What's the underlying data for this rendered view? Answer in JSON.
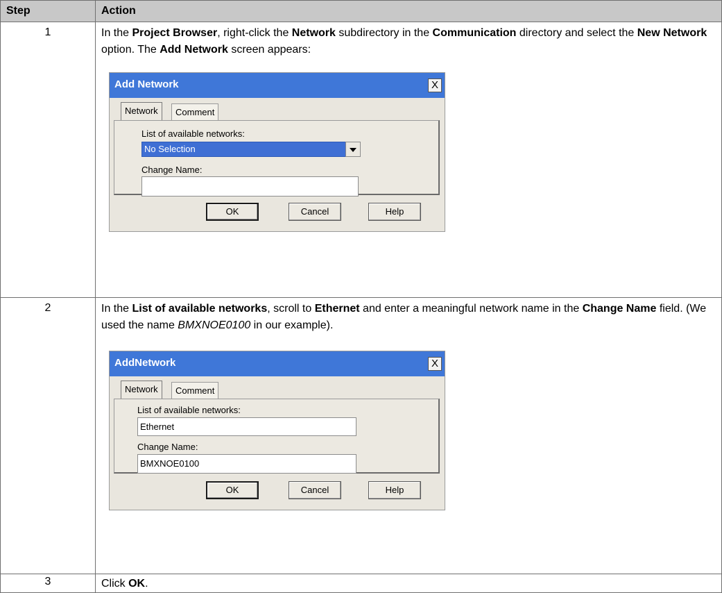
{
  "table": {
    "header_step": "Step",
    "header_action": "Action"
  },
  "rows": [
    {
      "step": "1",
      "text_a": "In the ",
      "bold_a": "Project Browser",
      "text_b": ", right-click the ",
      "bold_b": "Network",
      "text_c": " subdirectory in the ",
      "bold_c": "Communication",
      "text_d": " directory and select the ",
      "bold_d": "New Network",
      "text_e": " option. The ",
      "bold_e": "Add Network",
      "text_f": " screen appears:"
    },
    {
      "step": "2",
      "text_a": "In the ",
      "bold_a": "List of available networks",
      "text_b": ", scroll to ",
      "bold_b": "Ethernet",
      "text_c": " and enter a meaningful network name in the ",
      "bold_c": "Change Name",
      "text_d": " field. (We used the name ",
      "italic_d": "BMXNOE0100",
      "text_e": " in our example)."
    },
    {
      "step": "3",
      "text_a": "Click ",
      "bold_a": "OK",
      "text_b": "."
    }
  ],
  "dialog1": {
    "title": "Add Network",
    "close": "X",
    "tab_network": "Network",
    "tab_comment": "Comment",
    "list_label": "List of available networks:",
    "list_value": "No Selection",
    "name_label": "Change Name:",
    "name_value": "",
    "ok": "OK",
    "cancel": "Cancel",
    "help": "Help"
  },
  "dialog2": {
    "title": "AddNetwork",
    "close": "X",
    "tab_network": "Network",
    "tab_comment": "Comment",
    "list_label": "List of available networks:",
    "list_value": "Ethernet",
    "name_label": "Change Name:",
    "name_value": "BMXNOE0100",
    "ok": "OK",
    "cancel": "Cancel",
    "help": "Help"
  },
  "colors": {
    "title_bar": "#3f77d8",
    "dialog_bg": "#e9e6de",
    "header_bg": "#c8c8c8",
    "selection": "#3f6fd4"
  }
}
